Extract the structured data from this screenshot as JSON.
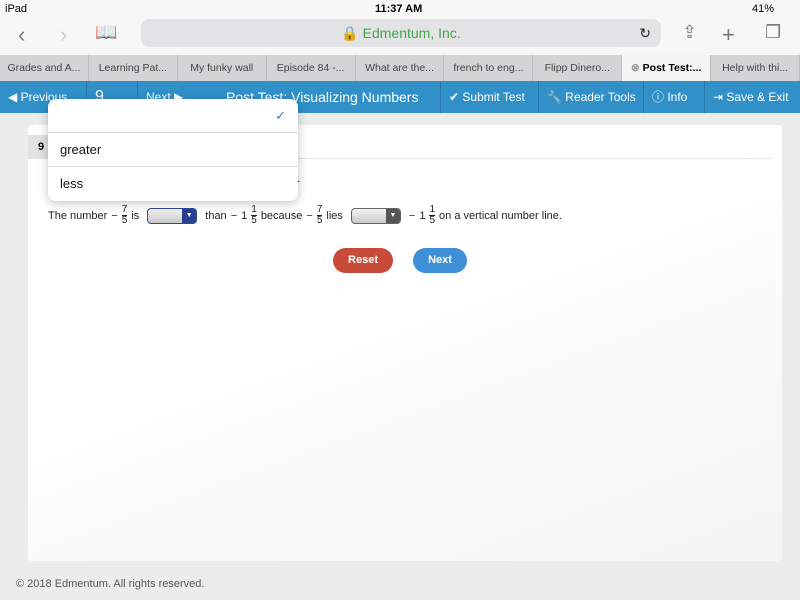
{
  "status": {
    "device": "iPad",
    "time": "11:37 AM",
    "battery": "41%"
  },
  "browser": {
    "url": "Edmentum, Inc.",
    "tabs": [
      "Grades and A...",
      "Learning Pat...",
      "My funky wall",
      "Episode 84 -...",
      "What are the...",
      "french to eng...",
      "Flipp Dinero...",
      "Post Test:...",
      "Help with thi..."
    ],
    "active_tab": 7
  },
  "toolbar": {
    "previous": "Previous",
    "question_selector": "9",
    "next": "Next",
    "title": "Post Test: Visualizing Numbers",
    "submit": "Submit Test",
    "reader": "Reader Tools",
    "info": "Info",
    "save": "Save & Exit"
  },
  "question": {
    "number": "9",
    "instruction_fragment": "nu.",
    "p1": "The number",
    "f1": {
      "sign": "−",
      "num": "7",
      "den": "5"
    },
    "p2": "is",
    "p3": "than",
    "f2": {
      "sign": "−",
      "whole": "1",
      "num": "1",
      "den": "5"
    },
    "p4": "because",
    "p5": "lies",
    "p6": "on a vertical number line."
  },
  "dropdown": {
    "options": [
      "",
      "greater",
      "less"
    ],
    "selected": 0
  },
  "buttons": {
    "reset": "Reset",
    "next": "Next"
  },
  "footer": "© 2018 Edmentum. All rights reserved.",
  "colors": {
    "toolbar": "#3190c8",
    "reset": "#c84b3a",
    "next": "#3e8fd6",
    "url": "#3ea84a"
  }
}
